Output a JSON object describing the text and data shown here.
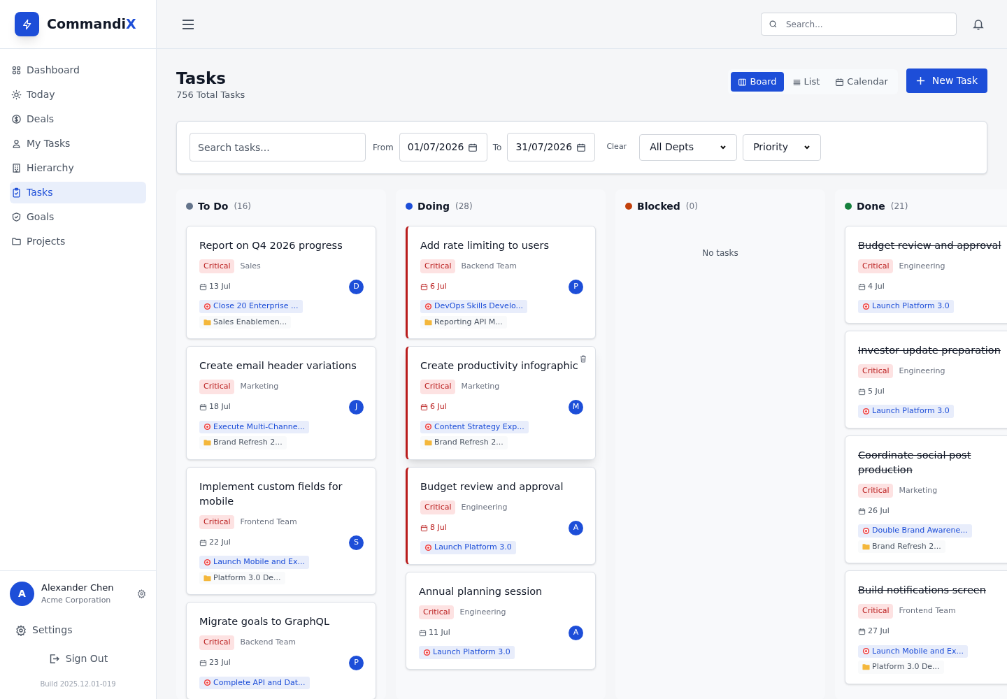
{
  "brand": {
    "name": "Commandi",
    "accent": "X"
  },
  "nav": [
    {
      "label": "Dashboard",
      "selected": false
    },
    {
      "label": "Today",
      "selected": false
    },
    {
      "label": "Deals",
      "selected": false
    },
    {
      "label": "My Tasks",
      "selected": false
    },
    {
      "label": "Hierarchy",
      "selected": false
    },
    {
      "label": "Tasks",
      "selected": true
    },
    {
      "label": "Goals",
      "selected": false
    },
    {
      "label": "Projects",
      "selected": false
    }
  ],
  "user": {
    "initial": "A",
    "name": "Alexander Chen",
    "company": "Acme Corporation"
  },
  "settings_label": "Settings",
  "signout_label": "Sign Out",
  "build": "Build 2025.12.01-019",
  "search": {
    "placeholder": "Search..."
  },
  "page": {
    "title": "Tasks",
    "subtitle": "756 Total Tasks"
  },
  "views": [
    {
      "label": "Board",
      "selected": true
    },
    {
      "label": "List",
      "selected": false
    },
    {
      "label": "Calendar",
      "selected": false
    }
  ],
  "new_task": "New Task",
  "filters": {
    "search_placeholder": "Search tasks...",
    "from_label": "From",
    "from": "01/07/2026",
    "to_label": "To",
    "to": "31/07/2026",
    "clear": "Clear",
    "dept": "All Depts",
    "priority": "Priority"
  },
  "columns": [
    {
      "name": "To Do",
      "count": "(16)",
      "color": "#64748b",
      "cards": [
        {
          "title": "Report on Q4 2026 progress",
          "priority": "Critical",
          "team": "Sales",
          "date": "13 Jul",
          "assignee": "D",
          "goal": "Close 20 Enterprise ...",
          "project": "Sales Enablemen...",
          "overdue": false,
          "completed": false,
          "hovered": false
        },
        {
          "title": "Create email header variations",
          "priority": "Critical",
          "team": "Marketing",
          "date": "18 Jul",
          "assignee": "J",
          "goal": "Execute Multi-Channe...",
          "project": "Brand Refresh 2...",
          "overdue": false,
          "completed": false,
          "hovered": false
        },
        {
          "title": "Implement custom fields for mobile",
          "priority": "Critical",
          "team": "Frontend Team",
          "date": "22 Jul",
          "assignee": "S",
          "goal": "Launch Mobile and Ex...",
          "project": "Platform 3.0 De...",
          "overdue": false,
          "completed": false,
          "hovered": false
        },
        {
          "title": "Migrate goals to GraphQL",
          "priority": "Critical",
          "team": "Backend Team",
          "date": "23 Jul",
          "assignee": "P",
          "goal": "Complete API and Dat...",
          "overdue": false,
          "completed": false,
          "hovered": false
        }
      ]
    },
    {
      "name": "Doing",
      "count": "(28)",
      "color": "#1d4ed8",
      "cards": [
        {
          "title": "Add rate limiting to users",
          "priority": "Critical",
          "team": "Backend Team",
          "date": "6 Jul",
          "assignee": "P",
          "goal": "DevOps Skills Develo...",
          "project": "Reporting API M...",
          "overdue": true,
          "completed": false,
          "hovered": false
        },
        {
          "title": "Create productivity infographic",
          "priority": "Critical",
          "team": "Marketing",
          "date": "6 Jul",
          "assignee": "M",
          "goal": "Content Strategy Exp...",
          "project": "Brand Refresh 2...",
          "overdue": true,
          "completed": false,
          "hovered": true
        },
        {
          "title": "Budget review and approval",
          "priority": "Critical",
          "team": "Engineering",
          "date": "8 Jul",
          "assignee": "A",
          "goal": "Launch Platform 3.0",
          "overdue": true,
          "completed": false,
          "hovered": false
        },
        {
          "title": "Annual planning session",
          "priority": "Critical",
          "team": "Engineering",
          "date": "11 Jul",
          "assignee": "A",
          "goal": "Launch Platform 3.0",
          "overdue": false,
          "completed": false,
          "hovered": false
        }
      ]
    },
    {
      "name": "Blocked",
      "count": "(0)",
      "color": "#c2410c",
      "empty": "No tasks"
    },
    {
      "name": "Done",
      "count": "(21)",
      "color": "#15803d",
      "cards": [
        {
          "title": "Budget review and approval",
          "priority": "Critical",
          "team": "Engineering",
          "date": "4 Jul",
          "goal": "Launch Platform 3.0",
          "overdue": false,
          "completed": true
        },
        {
          "title": "Investor update preparation",
          "priority": "Critical",
          "team": "Engineering",
          "date": "5 Jul",
          "goal": "Launch Platform 3.0",
          "overdue": false,
          "completed": true
        },
        {
          "title": "Coordinate social post production",
          "priority": "Critical",
          "team": "Marketing",
          "date": "26 Jul",
          "goal": "Double Brand Awarene...",
          "project": "Brand Refresh 2...",
          "overdue": false,
          "completed": true
        },
        {
          "title": "Build notifications screen",
          "priority": "Critical",
          "team": "Frontend Team",
          "date": "27 Jul",
          "goal": "Launch Mobile and Ex...",
          "project": "Platform 3.0 De...",
          "overdue": false,
          "completed": true
        }
      ]
    }
  ]
}
